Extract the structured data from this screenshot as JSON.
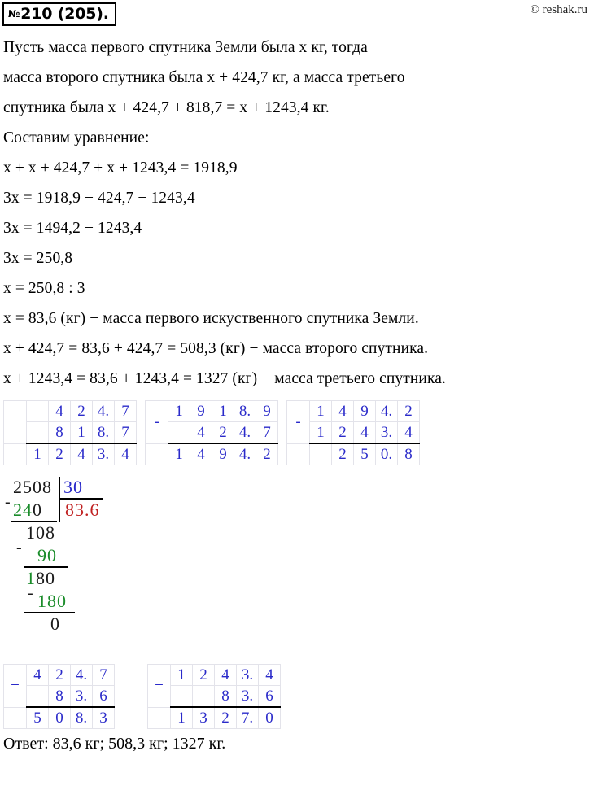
{
  "header": {
    "task_number": "210 (205).",
    "numero_symbol": "№",
    "watermark": "© reshak.ru"
  },
  "solution_lines": [
    "Пусть масса первого спутника Земли была x кг, тогда",
    "масса второго спутника была x + 424,7 кг, а масса третьего",
    "спутника была x + 424,7 + 818,7 = x + 1243,4 кг.",
    "Составим уравнение:",
    "x + x + 424,7 + x + 1243,4 = 1918,9",
    "3x = 1918,9 − 424,7 − 1243,4",
    "3x = 1494,2 − 1243,4",
    "3x = 250,8",
    "x = 250,8 : 3",
    "x = 83,6 (кг) − масса первого искуственного спутника Земли.",
    "x + 424,7 = 83,6 + 424,7 = 508,3 (кг) − масса второго спутника.",
    "x + 1243,4 = 83,6 + 1243,4 = 1327 (кг) − масса третьего спутника."
  ],
  "calc_row_1": [
    {
      "name": "addition-424-7-plus-818-7",
      "operator": "+",
      "operand1": [
        "4",
        "2",
        "4.",
        "7"
      ],
      "operand2": [
        "8",
        "1",
        "8.",
        "7"
      ],
      "result": [
        "1",
        "2",
        "4",
        "3.",
        "4"
      ],
      "digit_color": "#2a2aca"
    },
    {
      "name": "subtraction-1918-9-minus-424-7",
      "operator": "-",
      "operand1": [
        "1",
        "9",
        "1",
        "8.",
        "9"
      ],
      "operand2": [
        "",
        "4",
        "2",
        "4.",
        "7"
      ],
      "result": [
        "1",
        "4",
        "9",
        "4.",
        "2"
      ],
      "digit_color": "#2a2aca"
    },
    {
      "name": "subtraction-1494-2-minus-1243-4",
      "operator": "-",
      "operand1": [
        "1",
        "4",
        "9",
        "4.",
        "2"
      ],
      "operand2": [
        "1",
        "2",
        "4",
        "3.",
        "4"
      ],
      "result": [
        "",
        "2",
        "5",
        "0.",
        "8"
      ],
      "digit_color": "#2a2aca"
    }
  ],
  "long_division": {
    "dividend": "2508",
    "divisor": "30",
    "quotient_first": "8",
    "quotient_rest": "3.6",
    "subtrahend_1": "24",
    "subtrahend_1_zero": "0",
    "remainder_1": "108",
    "subtrahend_2": "90",
    "remainder_2_first": "1",
    "remainder_2_rest": "80",
    "subtrahend_3": "180",
    "remainder_final": "0",
    "minus_sign": "-",
    "colors": {
      "divisor": "#2a2aca",
      "quotient": "#c02020",
      "subtrahend": "#1a8c2a",
      "plain": "#1a1a1a"
    }
  },
  "calc_row_2": [
    {
      "name": "addition-424-7-plus-83-6",
      "operator": "+",
      "operand1": [
        "4",
        "2",
        "4.",
        "7"
      ],
      "operand2": [
        "",
        "8",
        "3.",
        "6"
      ],
      "result": [
        "5",
        "0",
        "8.",
        "3"
      ],
      "digit_color": "#2a2aca"
    },
    {
      "name": "addition-1243-4-plus-83-6",
      "operator": "+",
      "operand1": [
        "1",
        "2",
        "4",
        "3.",
        "4"
      ],
      "operand2": [
        "",
        "",
        "8",
        "3.",
        "6"
      ],
      "result": [
        "1",
        "3",
        "2",
        "7.",
        "0"
      ],
      "digit_color": "#2a2aca"
    }
  ],
  "answer": {
    "label": "Ответ:",
    "values": "83,6 кг;   508,3 кг;   1327 кг.",
    "full": "Ответ: 83,6 кг;   508,3 кг;   1327 кг."
  }
}
